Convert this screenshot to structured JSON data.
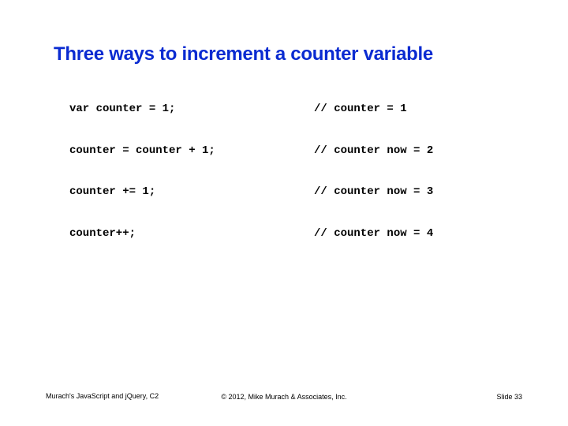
{
  "title": "Three ways to increment a counter variable",
  "code": {
    "lines": [
      {
        "left": "var counter = 1;",
        "right": "// counter = 1"
      },
      {
        "left": "counter = counter + 1;",
        "right": "// counter now = 2"
      },
      {
        "left": "counter += 1;",
        "right": "// counter now = 3"
      },
      {
        "left": "counter++;",
        "right": "// counter now = 4"
      }
    ]
  },
  "footer": {
    "left": "Murach's JavaScript and jQuery, C2",
    "center": "© 2012, Mike Murach & Associates, Inc.",
    "right": "Slide 33"
  }
}
